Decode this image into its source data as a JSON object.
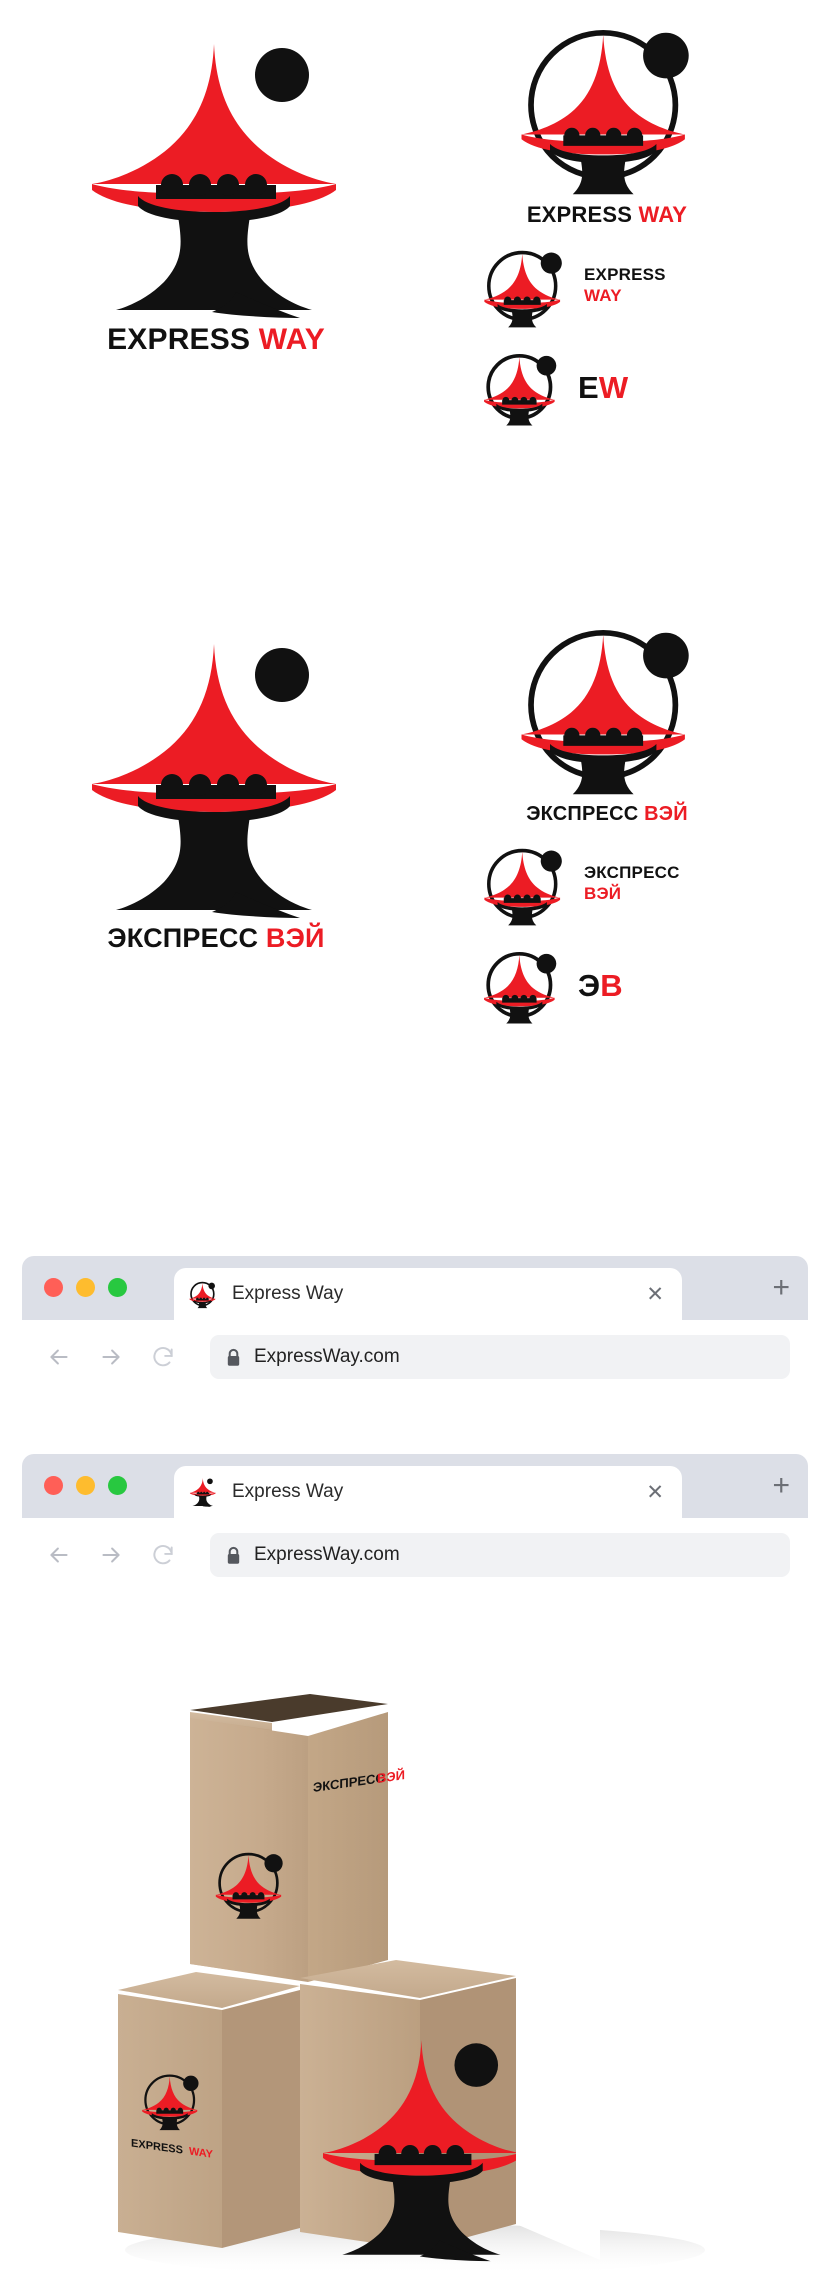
{
  "brand": {
    "colors": {
      "red": "#EC1C24",
      "black": "#111111",
      "cardboard": "#C9AE92",
      "chrome": "#DCDFE7"
    },
    "en": {
      "word_dark": "EXPRESS",
      "word_red": "WAY",
      "monogram_dark": "E",
      "monogram_red": "W"
    },
    "ru": {
      "word_dark": "ЭКСПРЕСС",
      "word_red": "ВЭЙ",
      "monogram_dark": "Э",
      "monogram_red": "В"
    }
  },
  "browsers": [
    {
      "tab_title": "Express Way",
      "url": "ExpressWay.com",
      "close_label": "✕",
      "newtab_label": "+",
      "favicon": "pagoda-circle-favicon",
      "traffic_lights": [
        "#FF5F57",
        "#FEBC2E",
        "#28C840"
      ]
    },
    {
      "tab_title": "Express Way",
      "url": "ExpressWay.com",
      "close_label": "✕",
      "newtab_label": "+",
      "favicon": "pagoda-solid-favicon",
      "traffic_lights": [
        "#FF5F57",
        "#FEBC2E",
        "#28C840"
      ]
    }
  ],
  "packaging": {
    "top_box_side_text_dark": "ЭКСПРЕСС",
    "top_box_side_text_red": "ВЭЙ",
    "left_box_text_dark": "EXPRESS",
    "left_box_text_red": "WAY"
  }
}
